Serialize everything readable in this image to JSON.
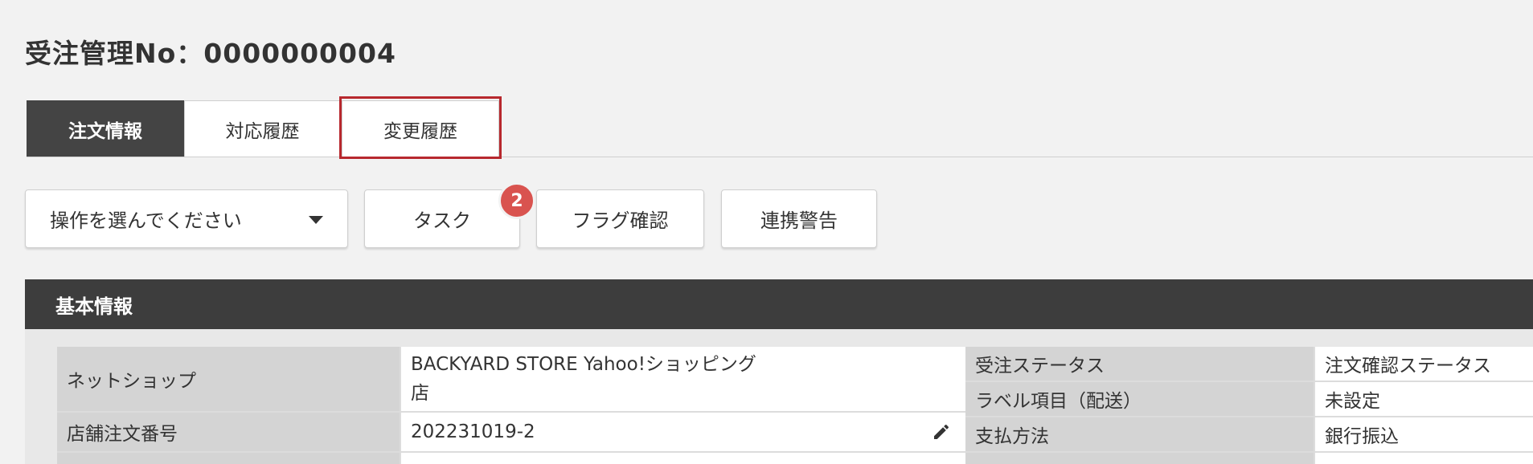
{
  "header": {
    "title": "受注管理No：0000000004"
  },
  "tabs": [
    {
      "label": "注文情報"
    },
    {
      "label": "対応履歴"
    },
    {
      "label": "変更履歴"
    }
  ],
  "toolbar": {
    "operation_select": "操作を選んでください",
    "task_label": "タスク",
    "task_badge": "2",
    "flag_label": "フラグ確認",
    "alert_label": "連携警告"
  },
  "basic_info": {
    "title": "基本情報",
    "left_rows": [
      {
        "label": "ネットショップ",
        "value_line1": "BACKYARD STORE Yahoo!ショッピング",
        "value_line2": "店"
      },
      {
        "label": "店舗注文番号",
        "value": "202231019-2"
      }
    ],
    "right_rows": [
      {
        "label": "受注ステータス",
        "value": "注文確認ステータス"
      },
      {
        "label": "ラベル項目（配送）",
        "value": "未設定"
      },
      {
        "label": "支払方法",
        "value": "銀行振込"
      }
    ]
  },
  "icons": {
    "edit": "pencil-icon",
    "dropdown": "chevron-down-icon"
  },
  "colors": {
    "active_tab": "#444444",
    "highlight": "#b7282e",
    "badge": "#d9534f",
    "section_header": "#3d3d3d"
  }
}
